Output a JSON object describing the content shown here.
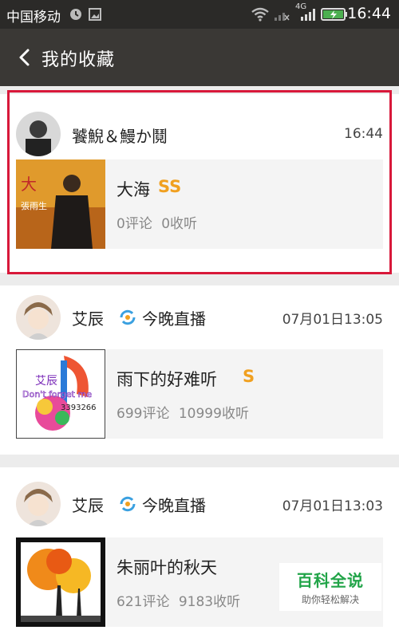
{
  "statusbar": {
    "carrier": "中国移动",
    "network": "4G",
    "time": "16:44"
  },
  "header": {
    "title": "我的收藏"
  },
  "items": [
    {
      "user": "饕鯢＆鰻か鬩",
      "timestamp": "16:44",
      "song_title": "大海",
      "quality": "SS",
      "comments": "0评论",
      "listens": "0收听",
      "cover_text": "張雨生"
    },
    {
      "user": "艾辰",
      "tag": "今晚直播",
      "timestamp": "07月01日13:05",
      "song_title": "雨下的好难听",
      "quality": "S",
      "comments": "699评论",
      "listens": "10999收听",
      "cover_text_1": "艾辰",
      "cover_text_2": "Don't forget me",
      "cover_text_3": "3393266"
    },
    {
      "user": "艾辰",
      "tag": "今晚直播",
      "timestamp": "07月01日13:03",
      "song_title": "朱丽叶的秋天",
      "comments": "621评论",
      "listens": "9183收听"
    }
  ],
  "watermark": {
    "title": "百科全说",
    "subtitle": "助你轻松解决"
  },
  "colors": {
    "accent": "#f0a020",
    "highlight": "#d8183a",
    "brand": "#21a448"
  }
}
